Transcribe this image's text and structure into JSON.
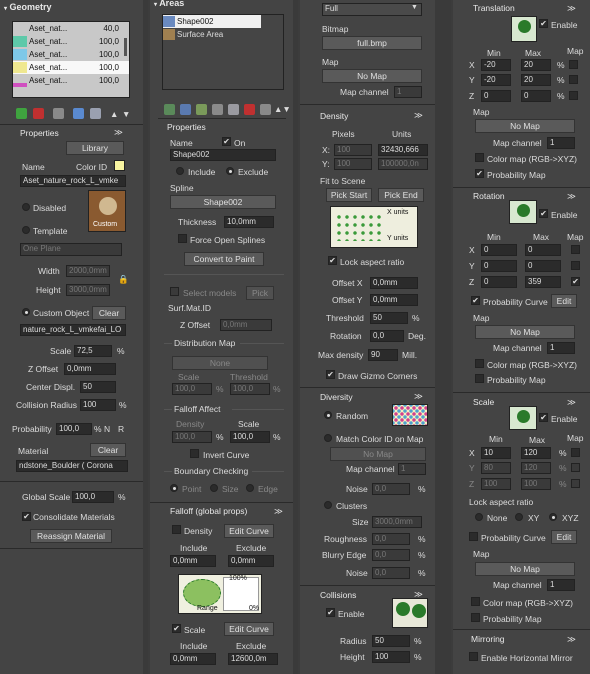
{
  "geom": {
    "title": "Geometry",
    "items": [
      {
        "name": "Aset_nat...",
        "val": "40,0",
        "color": "#c8c8c8"
      },
      {
        "name": "Aset_nat...",
        "val": "100,0",
        "color": "#5ec9a9"
      },
      {
        "name": "Aset_nat...",
        "val": "100,0",
        "color": "#7ec8e8"
      },
      {
        "name": "Aset_nat...",
        "val": "100,0",
        "color": "#efe890"
      },
      {
        "name": "Aset_nat...",
        "val": "100,0",
        "color": "#d050c0"
      }
    ],
    "props_title": "Properties",
    "library": "Library",
    "name_lbl": "Name",
    "colorid_lbl": "Color ID",
    "name_val": "Aset_nature_rock_L_vmke",
    "disabled": "Disabled",
    "template": "Template",
    "custom": "Custom",
    "oneplane": "One Plane",
    "width_lbl": "Width",
    "width_val": "2000,0mm",
    "height_lbl": "Height",
    "height_val": "3000,0mm",
    "custom_object": "Custom Object",
    "clear": "Clear",
    "object_val": "nature_rock_L_vmkefai_LO",
    "scale_lbl": "Scale",
    "scale_val": "72,5",
    "zoffset_lbl": "Z Offset",
    "zoffset_val": "0,0mm",
    "center_lbl": "Center Displ.",
    "center_val": "50",
    "collision_lbl": "Collision Radius",
    "collision_val": "100",
    "prob_lbl": "Probability",
    "prob_val": "100,0",
    "n": "N",
    "r": "R",
    "material_lbl": "Material",
    "material_clear": "Clear",
    "material_val": "ndstone_Boulder  ( Corona",
    "global_scale_lbl": "Global Scale",
    "global_scale_val": "100,0",
    "consolidate": "Consolidate Materials",
    "reassign": "Reassign Material",
    "pct": "%"
  },
  "areas": {
    "title": "Areas",
    "items": [
      "Shape002",
      "Surface Area"
    ],
    "props_title": "Properties",
    "name_lbl": "Name",
    "on": "On",
    "name_val": "Shape002",
    "include": "Include",
    "exclude": "Exclude",
    "spline_lbl": "Spline",
    "spline_val": "Shape002",
    "thickness_lbl": "Thickness",
    "thickness_val": "10,0mm",
    "force_open": "Force Open Splines",
    "convert": "Convert to Paint",
    "select_models": "Select models",
    "pick": "Pick",
    "surfmat": "Surf.Mat.ID",
    "zoffset_lbl": "Z Offset",
    "zoffset_val": "0,0mm",
    "distmap_title": "Distribution Map",
    "none": "None",
    "scale_lbl": "Scale",
    "threshold_lbl": "Threshold",
    "scale_val": "100,0",
    "threshold_val": "100,0",
    "falloff_title": "Falloff Affect",
    "density_lbl": "Density",
    "density_val": "100,0",
    "fscale_val": "100,0",
    "invert": "Invert Curve",
    "boundary_title": "Boundary Checking",
    "point": "Point",
    "size": "Size",
    "edge": "Edge",
    "falloff_global_title": "Falloff (global props)",
    "density_chk": "Density",
    "edit_curve": "Edit Curve",
    "include2": "Include",
    "exclude2": "Exclude",
    "inc_val": "0,0mm",
    "exc_val": "0,0mm",
    "range": "Range",
    "pct100": "100%",
    "pct0": "0%",
    "scale_chk": "Scale",
    "edit_curve2": "Edit Curve",
    "include3": "Include",
    "exclude3": "Exclude",
    "inc_val2": "0,0mm",
    "exc_val2": "12600,0m"
  },
  "dist": {
    "full": "Full",
    "bitmap_lbl": "Bitmap",
    "bitmap_val": "full.bmp",
    "map_lbl": "Map",
    "nomap": "No Map",
    "mapch_lbl": "Map channel",
    "mapch_val": "1",
    "density_title": "Density",
    "pixels": "Pixels",
    "units": "Units",
    "x_lbl": "X:",
    "y_lbl": "Y:",
    "px_x": "100",
    "px_y": "100",
    "u_x": "32430,666",
    "u_y": "100000,0n",
    "fit": "Fit to Scene",
    "pick_start": "Pick Start",
    "pick_end": "Pick End",
    "x_units": "X units",
    "y_units": "Y units",
    "lock_aspect": "Lock aspect ratio",
    "offx_lbl": "Offset X",
    "offx_val": "0,0mm",
    "offy_lbl": "Offset Y",
    "offy_val": "0,0mm",
    "thr_lbl": "Threshold",
    "thr_val": "50",
    "rot_lbl": "Rotation",
    "rot_val": "0,0",
    "deg": "Deg.",
    "maxd_lbl": "Max density",
    "maxd_val": "90",
    "mill": "Mill.",
    "gizmo": "Draw Gizmo Corners",
    "diversity_title": "Diversity",
    "random": "Random",
    "match": "Match Color ID on Map",
    "div_nomap": "No Map",
    "div_mapch": "Map channel",
    "div_mapch_val": "1",
    "noise_lbl": "Noise",
    "noise_val": "0,0",
    "clusters": "Clusters",
    "size_lbl": "Size",
    "size_val": "3000,0mm",
    "rough_lbl": "Roughness",
    "rough_val": "0,0",
    "blurry_lbl": "Blurry Edge",
    "blurry_val": "0,0",
    "noise2_lbl": "Noise",
    "noise2_val": "0,0",
    "collisions_title": "Collisions",
    "enable": "Enable",
    "radius_lbl": "Radius",
    "radius_val": "50",
    "height_lbl": "Height",
    "height_val": "100"
  },
  "transform": {
    "translation_title": "Translation",
    "enable": "Enable",
    "min": "Min",
    "max": "Max",
    "map": "Map",
    "tx": [
      "-20",
      "20"
    ],
    "ty": [
      "-20",
      "20"
    ],
    "tz": [
      "0",
      "0"
    ],
    "nomap": "No Map",
    "map_lbl": "Map",
    "mapch_lbl": "Map channel",
    "mapch_val": "1",
    "colormap": "Color map (RGB->XYZ)",
    "probmap": "Probability Map",
    "rotation_title": "Rotation",
    "rx": [
      "0",
      "0"
    ],
    "ry": [
      "0",
      "0"
    ],
    "rz": [
      "0",
      "359"
    ],
    "prob_curve": "Probability Curve",
    "edit": "Edit",
    "scale_title": "Scale",
    "sx": [
      "10",
      "120"
    ],
    "sy": [
      "80",
      "120"
    ],
    "sz": [
      "100",
      "100"
    ],
    "lock_aspect": "Lock aspect ratio",
    "none": "None",
    "xy": "XY",
    "xyz": "XYZ",
    "mirroring_title": "Mirroring",
    "enable_mirror": "Enable Horizontal Mirror",
    "x": "X",
    "y": "Y",
    "z": "Z",
    "pct": "%"
  }
}
